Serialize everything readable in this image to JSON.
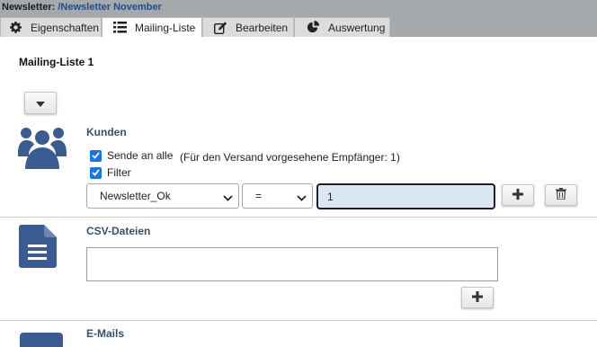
{
  "header": {
    "label": "Newsletter:",
    "path": "/Newsletter November"
  },
  "tabs": [
    {
      "label": "Eigenschaften",
      "icon": "gear-icon"
    },
    {
      "label": "Mailing-Liste",
      "icon": "list-icon"
    },
    {
      "label": "Bearbeiten",
      "icon": "edit-icon"
    },
    {
      "label": "Auswertung",
      "icon": "pie-chart-icon"
    }
  ],
  "active_tab": "Mailing-Liste",
  "page": {
    "title": "Mailing-Liste 1"
  },
  "kunden": {
    "heading": "Kunden",
    "send_all_label": "Sende an alle",
    "send_all_checked": true,
    "recipients_note": "(Für den Versand vorgesehene Empfänger: 1)",
    "filter_label": "Filter",
    "filter_checked": true,
    "field_select": "Newsletter_Ok",
    "operator_select": "=",
    "value_input": "1"
  },
  "csv": {
    "heading": "CSV-Dateien",
    "textarea_value": ""
  },
  "emails": {
    "heading": "E-Mails"
  },
  "colors": {
    "accent_blue": "#3b5b93",
    "header_gray": "#a6a9ac",
    "link_blue": "#1d4e8f",
    "checkbox_blue": "#1a73e8"
  }
}
